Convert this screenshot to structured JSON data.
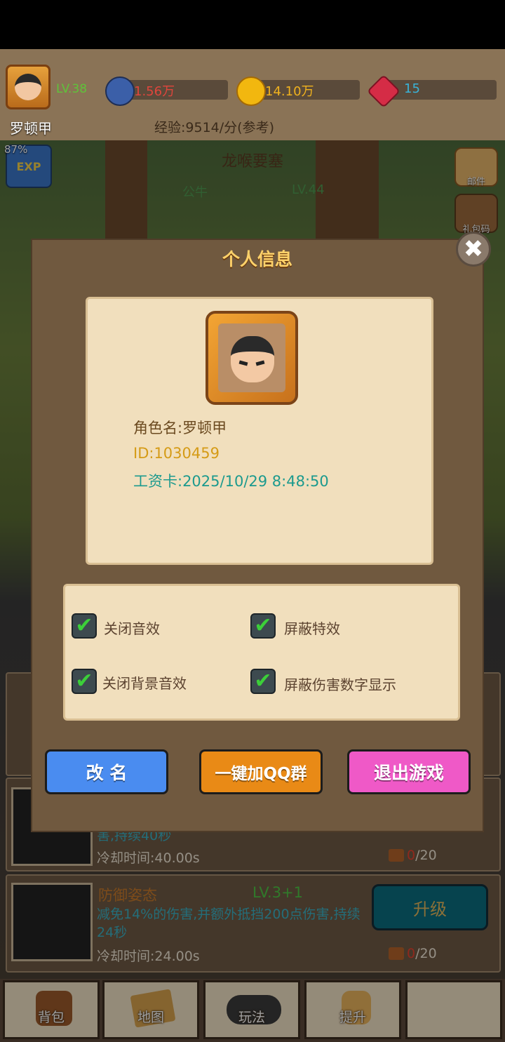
{
  "hud": {
    "level": "LV.38",
    "power": "1.56万",
    "gold": "14.10万",
    "gems": "15",
    "player_name": "罗顿甲",
    "exp_rate": "经验:9514/分(参考)",
    "exp_pct": "87%"
  },
  "scene": {
    "stage_name": "龙喉要塞",
    "enemy_name": "公牛",
    "enemy_level": "LV.44",
    "side_buttons": [
      "邮件",
      "礼包码"
    ]
  },
  "modal": {
    "title": "个人信息",
    "role_name": "角色名:罗顿甲",
    "player_id": "ID:1030459",
    "salary_card": "工资卡:2025/10/29 8:48:50",
    "settings": [
      {
        "label": "关闭音效",
        "checked": true
      },
      {
        "label": "屏蔽特效",
        "checked": true
      },
      {
        "label": "关闭背景音效",
        "checked": true
      },
      {
        "label": "屏蔽伤害数字显示",
        "checked": true
      }
    ],
    "checkmark": "✔",
    "close_glyph": "✖",
    "buttons": {
      "rename": "改 名",
      "join_qq": "一键加QQ群",
      "quit": "退出游戏"
    }
  },
  "skills": [
    {
      "desc_fragment": "害,持续40秒",
      "cooldown": "冷却时间:40.00s",
      "count_have": "0",
      "count_total": "/20"
    },
    {
      "name": "防御姿态",
      "level": "LV.3+1",
      "desc": "减免14%的伤害,并额外抵挡200点伤害,持续24秒",
      "cooldown": "冷却时间:24.00s",
      "count_have": "0",
      "count_total": "/20",
      "upgrade_label": "升级"
    }
  ],
  "nav": [
    "背包",
    "地图",
    "玩法",
    "提升",
    ""
  ],
  "colors": {
    "rename_btn": "#4a8cf0",
    "qq_btn": "#e98a16",
    "quit_btn": "#ef59c7"
  }
}
